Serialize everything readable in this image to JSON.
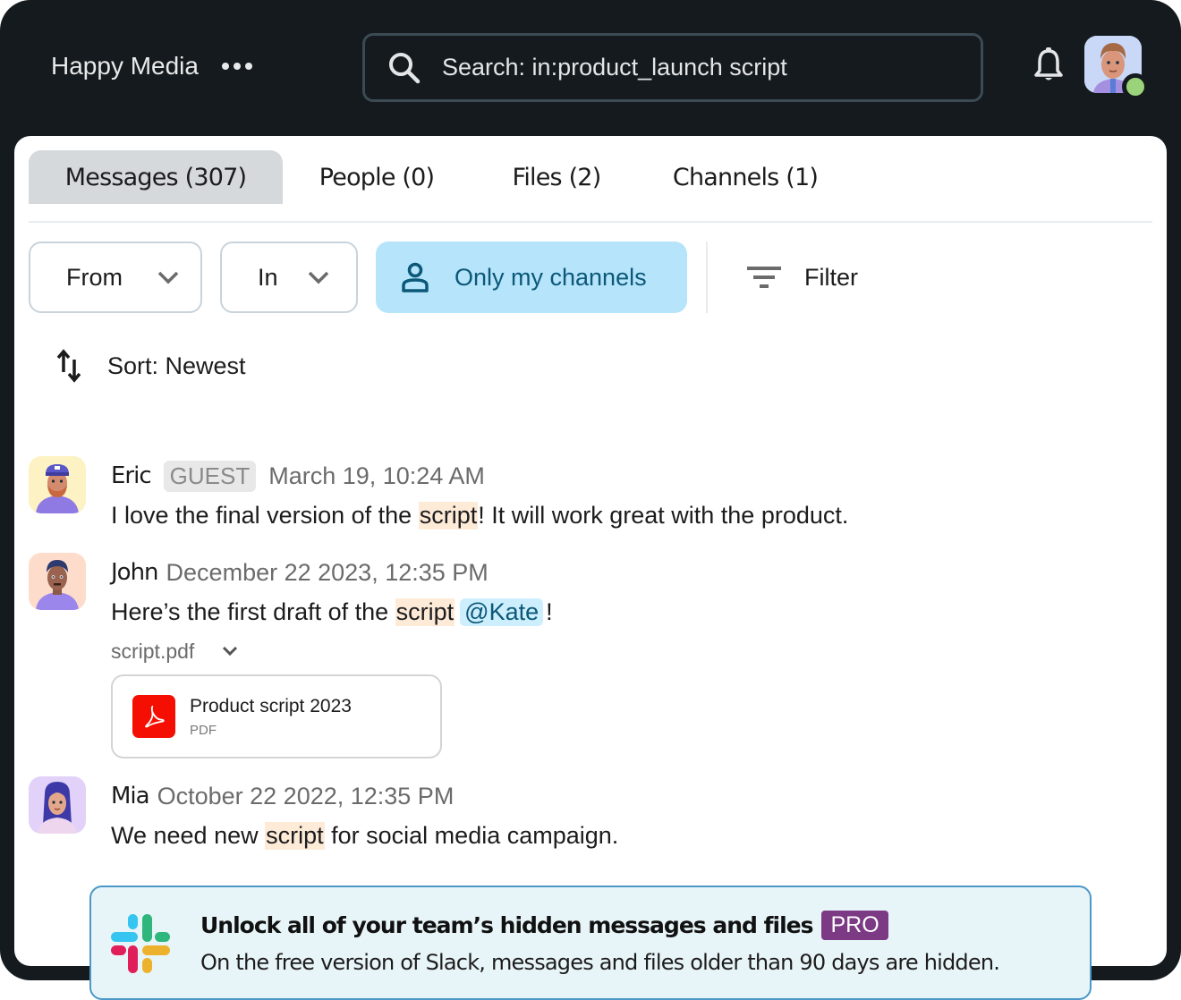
{
  "header": {
    "workspace_name": "Happy Media",
    "more_icon": "more-horizontal-icon",
    "search_value": "Search: in:product_launch script",
    "search_icon": "search-icon",
    "notifications_icon": "bell-icon",
    "user_status": "online"
  },
  "tabs": [
    {
      "label": "Messages (307)",
      "active": true
    },
    {
      "label": "People (0)",
      "active": false
    },
    {
      "label": "Files (2)",
      "active": false
    },
    {
      "label": "Channels (1)",
      "active": false
    }
  ],
  "filters": {
    "from_label": "From",
    "in_label": "In",
    "only_my_channels_label": "Only my channels",
    "only_my_channels_active": true,
    "filter_label": "Filter"
  },
  "sort": {
    "label": "Sort: Newest"
  },
  "messages": [
    {
      "author": "Eric",
      "badge": "GUEST",
      "timestamp": "March 19, 10:24 AM",
      "text_before": "I love the final version of the ",
      "highlight": "script",
      "text_after": "! It will work great with the product."
    },
    {
      "author": "John",
      "timestamp": "December 22 2023, 12:35 PM",
      "text_before": "Here’s the first draft of the ",
      "highlight": "script",
      "mention": "@Kate",
      "text_after": "!",
      "attachment": {
        "filename": "script.pdf",
        "title": "Product script 2023",
        "type": "PDF"
      }
    },
    {
      "author": "Mia",
      "timestamp": "October 22 2022, 12:35 PM",
      "text_before": "We need new ",
      "highlight": "script",
      "text_after": " for social media campaign."
    }
  ],
  "banner": {
    "title": "Unlock all of your team’s hidden messages and files",
    "badge": "PRO",
    "subtitle": "On the free version of Slack, messages and files older than 90 days are hidden."
  },
  "colors": {
    "frame": "#141a1e",
    "highlight": "#fdebd8",
    "mention_bg": "#cdeefc",
    "active_filter": "#b6e4fa",
    "pro_badge": "#7c3a85",
    "banner_bg": "#e8f5f8",
    "banner_border": "#4b98c8"
  }
}
